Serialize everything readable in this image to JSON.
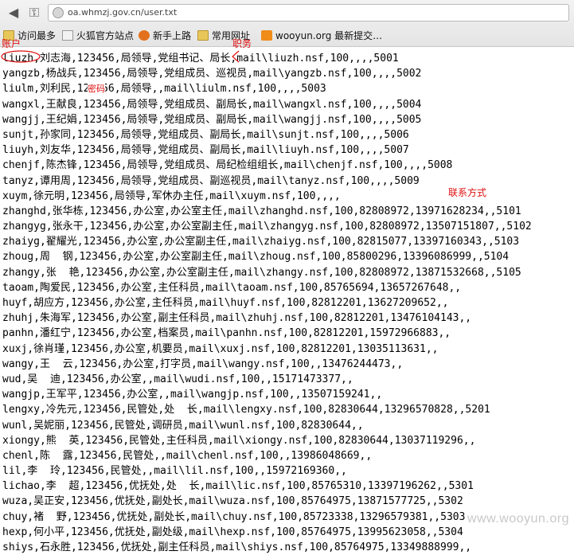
{
  "browser": {
    "url": "oa.whmzj.gov.cn/user.txt",
    "bookmarks": [
      {
        "label": "访问最多",
        "icon": "folder-icon"
      },
      {
        "label": "火狐官方站点",
        "icon": "page-icon"
      },
      {
        "label": "新手上路",
        "icon": "firefox-icon"
      },
      {
        "label": "常用网址",
        "icon": "folder-icon"
      },
      {
        "label": "wooyun.org 最新提交…",
        "icon": "rss-icon"
      }
    ]
  },
  "annotations": {
    "account": "账户",
    "position": "职务",
    "password": "密码",
    "contact": "联系方式"
  },
  "watermark": "www.wooyun.org",
  "file_lines": [
    "liuzh,刘志海,123456,局领导,党组书记、局长,mail\\liuzh.nsf,100,,,,5001",
    "yangzb,杨战兵,123456,局领导,党组成员、巡视员,mail\\yangzb.nsf,100,,,,5002",
    "liulm,刘利民,123456,局领导,,mail\\liulm.nsf,100,,,,5003",
    "wangxl,王献良,123456,局领导,党组成员、副局长,mail\\wangxl.nsf,100,,,,5004",
    "wangjj,王纪娟,123456,局领导,党组成员、副局长,mail\\wangjj.nsf,100,,,,5005",
    "sunjt,孙家同,123456,局领导,党组成员、副局长,mail\\sunjt.nsf,100,,,,5006",
    "liuyh,刘友华,123456,局领导,党组成员、副局长,mail\\liuyh.nsf,100,,,,5007",
    "chenjf,陈杰锋,123456,局领导,党组成员、局纪检组组长,mail\\chenjf.nsf,100,,,,5008",
    "tanyz,谭用周,123456,局领导,党组成员、副巡视员,mail\\tanyz.nsf,100,,,,5009",
    "xuym,徐元明,123456,局领导,军休办主任,mail\\xuym.nsf,100,,,,",
    "zhanghd,张华栋,123456,办公室,办公室主任,mail\\zhanghd.nsf,100,82808972,13971628234,,5101",
    "zhangyg,张永干,123456,办公室,办公室副主任,mail\\zhangyg.nsf,100,82808972,13507151807,,5102",
    "zhaiyg,翟耀光,123456,办公室,办公室副主任,mail\\zhaiyg.nsf,100,82815077,13397160343,,5103",
    "zhoug,周  钢,123456,办公室,办公室副主任,mail\\zhoug.nsf,100,85800296,13396086999,,5104",
    "zhangy,张  艳,123456,办公室,办公室副主任,mail\\zhangy.nsf,100,82808972,13871532668,,5105",
    "taoam,陶爱民,123456,办公室,主任科员,mail\\taoam.nsf,100,85765694,13657267648,,",
    "huyf,胡应方,123456,办公室,主任科员,mail\\huyf.nsf,100,82812201,13627209652,,",
    "zhuhj,朱海军,123456,办公室,副主任科员,mail\\zhuhj.nsf,100,82812201,13476104143,,",
    "panhn,潘红宁,123456,办公室,档案员,mail\\panhn.nsf,100,82812201,15972966883,,",
    "xuxj,徐肖瑾,123456,办公室,机要员,mail\\xuxj.nsf,100,82812201,13035113631,,",
    "wangy,王  云,123456,办公室,打字员,mail\\wangy.nsf,100,,13476244473,,",
    "wud,吴  迪,123456,办公室,,mail\\wudi.nsf,100,,15171473377,,",
    "wangjp,王军平,123456,办公室,,mail\\wangjp.nsf,100,,13507159241,,",
    "lengxy,冷先元,123456,民管处,处  长,mail\\lengxy.nsf,100,82830644,13296570828,,5201",
    "wunl,吴妮丽,123456,民管处,调研员,mail\\wunl.nsf,100,82830644,,",
    "xiongy,熊  英,123456,民管处,主任科员,mail\\xiongy.nsf,100,82830644,13037119296,,",
    "chenl,陈  露,123456,民管处,,mail\\chenl.nsf,100,,13986048669,,",
    "lil,李  玲,123456,民管处,,mail\\lil.nsf,100,,15972169360,,",
    "lichao,李  超,123456,优抚处,处  长,mail\\lic.nsf,100,85765310,13397196262,,5301",
    "wuza,吴正安,123456,优抚处,副处长,mail\\wuza.nsf,100,85764975,13871577725,,5302",
    "chuy,褚  野,123456,优抚处,副处长,mail\\chuy.nsf,100,85723338,13296579381,,5303",
    "hexp,何小平,123456,优抚处,副处级,mail\\hexp.nsf,100,85764975,13995623058,,5304",
    "shiys,石永胜,123456,优抚处,副主任科员,mail\\shiys.nsf,100,85764975,13349888999,,"
  ]
}
